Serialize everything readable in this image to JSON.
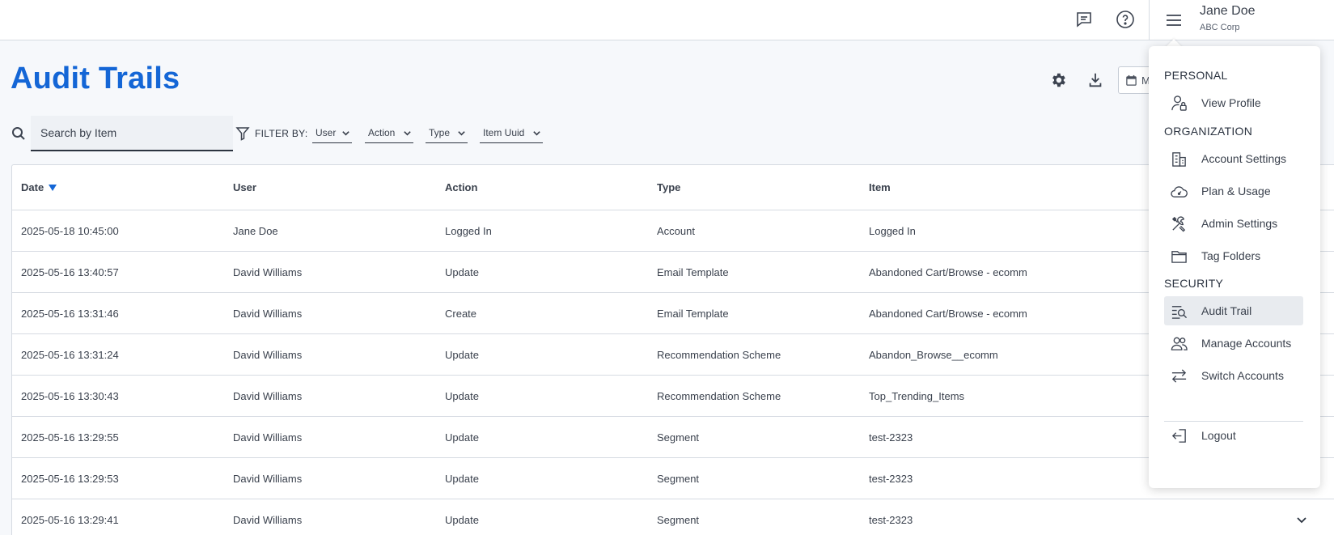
{
  "header": {
    "icons": {
      "chat": "chat-icon",
      "help": "help-icon",
      "menu": "menu-icon"
    },
    "user_name": "Jane Doe",
    "user_org": "ABC Corp"
  },
  "page": {
    "title": "Audit Trails",
    "date_button_label": "M",
    "tool_icons": [
      "settings-icon",
      "download-icon",
      "calendar-icon"
    ]
  },
  "search": {
    "placeholder": "Search by Item",
    "value": ""
  },
  "filter": {
    "label": "FILTER BY:",
    "options": [
      "User",
      "Action",
      "Type",
      "Item Uuid"
    ]
  },
  "table": {
    "columns": [
      "Date",
      "User",
      "Action",
      "Type",
      "Item"
    ],
    "sort_column": "Date",
    "sort_direction": "desc",
    "rows": [
      {
        "date": "2025-05-18 10:45:00",
        "user": "Jane Doe",
        "action": "Logged In",
        "type": "Account",
        "item": "Logged In"
      },
      {
        "date": "2025-05-16 13:40:57",
        "user": "David Williams",
        "action": "Update",
        "type": "Email Template",
        "item": "Abandoned Cart/Browse - ecomm"
      },
      {
        "date": "2025-05-16 13:31:46",
        "user": "David Williams",
        "action": "Create",
        "type": "Email Template",
        "item": "Abandoned Cart/Browse - ecomm"
      },
      {
        "date": "2025-05-16 13:31:24",
        "user": "David Williams",
        "action": "Update",
        "type": "Recommendation Scheme",
        "item": "Abandon_Browse__ecomm"
      },
      {
        "date": "2025-05-16 13:30:43",
        "user": "David Williams",
        "action": "Update",
        "type": "Recommendation Scheme",
        "item": "Top_Trending_Items"
      },
      {
        "date": "2025-05-16 13:29:55",
        "user": "David Williams",
        "action": "Update",
        "type": "Segment",
        "item": "test-2323"
      },
      {
        "date": "2025-05-16 13:29:53",
        "user": "David Williams",
        "action": "Update",
        "type": "Segment",
        "item": "test-2323"
      },
      {
        "date": "2025-05-16 13:29:41",
        "user": "David Williams",
        "action": "Update",
        "type": "Segment",
        "item": "test-2323"
      }
    ]
  },
  "menu": {
    "sections": [
      {
        "title": "PERSONAL",
        "items": [
          {
            "label": "View Profile",
            "icon": "user-lock-icon"
          }
        ]
      },
      {
        "title": "ORGANIZATION",
        "items": [
          {
            "label": "Account Settings",
            "icon": "building-icon"
          },
          {
            "label": "Plan & Usage",
            "icon": "gauge-cloud-icon"
          },
          {
            "label": "Admin Settings",
            "icon": "tools-icon"
          },
          {
            "label": "Tag Folders",
            "icon": "folder-icon"
          }
        ]
      },
      {
        "title": "SECURITY",
        "items": [
          {
            "label": "Audit Trail",
            "icon": "audit-list-icon",
            "active": true
          },
          {
            "label": "Manage Accounts",
            "icon": "users-icon"
          },
          {
            "label": "Switch Accounts",
            "icon": "swap-icon"
          }
        ]
      }
    ],
    "logout_label": "Logout"
  },
  "colors": {
    "accent": "#1466d6",
    "active_item_bg": "#e8ebef"
  }
}
